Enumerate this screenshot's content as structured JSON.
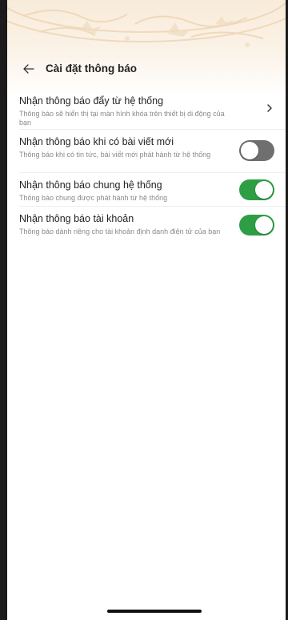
{
  "header": {
    "title": "Cài đặt thông báo",
    "back_icon": "arrow-left-icon"
  },
  "settings": [
    {
      "title": "Nhận thông báo đẩy từ hệ thống",
      "description": "Thông báo sẽ hiển thị tại màn hình khóa trên thiết bị di động của bạn",
      "control": "chevron",
      "icon": "chevron-right-icon"
    },
    {
      "title": "Nhận thông báo khi có bài viết mới",
      "description": "Thông báo khi có tin tức, bài viết mới phát hành từ hệ thống",
      "control": "toggle",
      "enabled": false
    },
    {
      "title": "Nhận thông báo chung hệ thống",
      "description": "Thông báo chung được phát hành từ hệ thống",
      "control": "toggle",
      "enabled": true
    },
    {
      "title": "Nhận thông báo tài khoản",
      "description": "Thông báo dành riêng cho tài khoản định danh điện tử của bạn",
      "control": "toggle",
      "enabled": true
    }
  ],
  "colors": {
    "toggle_on": "#2e9e44",
    "toggle_off": "#6f6f6f",
    "header_bg": "#f8ebd9"
  }
}
